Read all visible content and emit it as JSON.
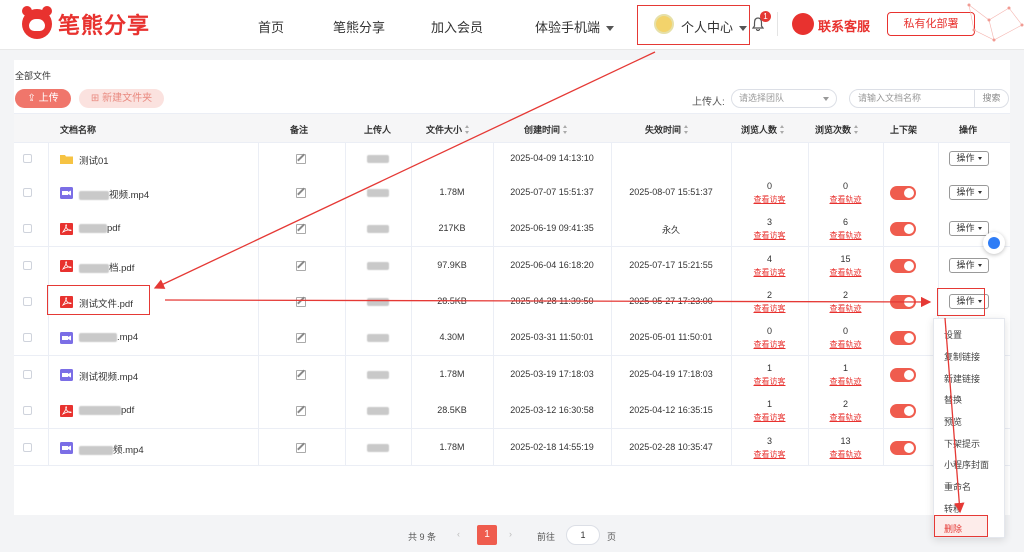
{
  "header": {
    "logo_text": "笔熊分享",
    "nav": [
      "首页",
      "笔熊分享",
      "加入会员",
      "体验手机端"
    ],
    "personal_center": "个人中心",
    "notification_count": "1",
    "service": "联系客服",
    "private_deploy": "私有化部署"
  },
  "toolbar": {
    "breadcrumb": "全部文件",
    "upload": "上传",
    "new_folder": "新建文件夹",
    "uploader_label": "上传人:",
    "team_placeholder": "请选择团队",
    "search_placeholder": "请输入文档名称",
    "search_btn": "搜索"
  },
  "columns": [
    "文档名称",
    "备注",
    "上传人",
    "文件大小",
    "创建时间",
    "失效时间",
    "浏览人数",
    "浏览次数",
    "上下架",
    "操作"
  ],
  "rows": [
    {
      "type": "folder",
      "name": "测试01",
      "size": "",
      "created": "2025-04-09 14:13:10",
      "expires": "",
      "viewers": "",
      "views": "",
      "toggle": false,
      "op": "操作"
    },
    {
      "type": "video",
      "name": "视频.mp4",
      "size": "1.78M",
      "created": "2025-07-07 15:51:37",
      "expires": "2025-08-07 15:51:37",
      "viewers": "0",
      "views": "0",
      "toggle": true,
      "op": "操作"
    },
    {
      "type": "pdf",
      "name": "pdf",
      "size": "217KB",
      "created": "2025-06-19 09:41:35",
      "expires": "永久",
      "viewers": "3",
      "views": "6",
      "toggle": true,
      "op": "操作"
    },
    {
      "type": "pdf",
      "name": "档.pdf",
      "size": "97.9KB",
      "created": "2025-06-04 16:18:20",
      "expires": "2025-07-17 15:21:55",
      "viewers": "4",
      "views": "15",
      "toggle": true,
      "op": "操作"
    },
    {
      "type": "pdf",
      "name": "测试文件.pdf",
      "size": "28.5KB",
      "created": "2025-04-28 11:39:50",
      "expires": "2025-05-27 17:23:00",
      "viewers": "2",
      "views": "2",
      "toggle": true,
      "op": "操作"
    },
    {
      "type": "video",
      "name": ".mp4",
      "size": "4.30M",
      "created": "2025-03-31 11:50:01",
      "expires": "2025-05-01 11:50:01",
      "viewers": "0",
      "views": "0",
      "toggle": true,
      "op": ""
    },
    {
      "type": "video",
      "name": "测试视频.mp4",
      "size": "1.78M",
      "created": "2025-03-19 17:18:03",
      "expires": "2025-04-19 17:18:03",
      "viewers": "1",
      "views": "1",
      "toggle": true,
      "op": ""
    },
    {
      "type": "pdf",
      "name": "pdf",
      "size": "28.5KB",
      "created": "2025-03-12 16:30:58",
      "expires": "2025-04-12 16:35:15",
      "viewers": "1",
      "views": "2",
      "toggle": true,
      "op": ""
    },
    {
      "type": "video",
      "name": "频.mp4",
      "size": "1.78M",
      "created": "2025-02-18 14:55:19",
      "expires": "2025-02-28 10:35:47",
      "viewers": "3",
      "views": "13",
      "toggle": true,
      "op": ""
    }
  ],
  "links": {
    "viewers": "查看访客",
    "views": "查看轨迹"
  },
  "menu": [
    "设置",
    "复制链接",
    "新建链接",
    "替换",
    "预览",
    "下架提示",
    "小程序封面",
    "重命名",
    "转移",
    "删除"
  ],
  "pager": {
    "total": "共 9 条",
    "current": "1",
    "goto": "前往",
    "goto_value": "1",
    "page_suffix": "页"
  },
  "colors": {
    "brand": "#e8322f",
    "toggle_on": "#ef5c4e",
    "annotation": "#e53935"
  }
}
